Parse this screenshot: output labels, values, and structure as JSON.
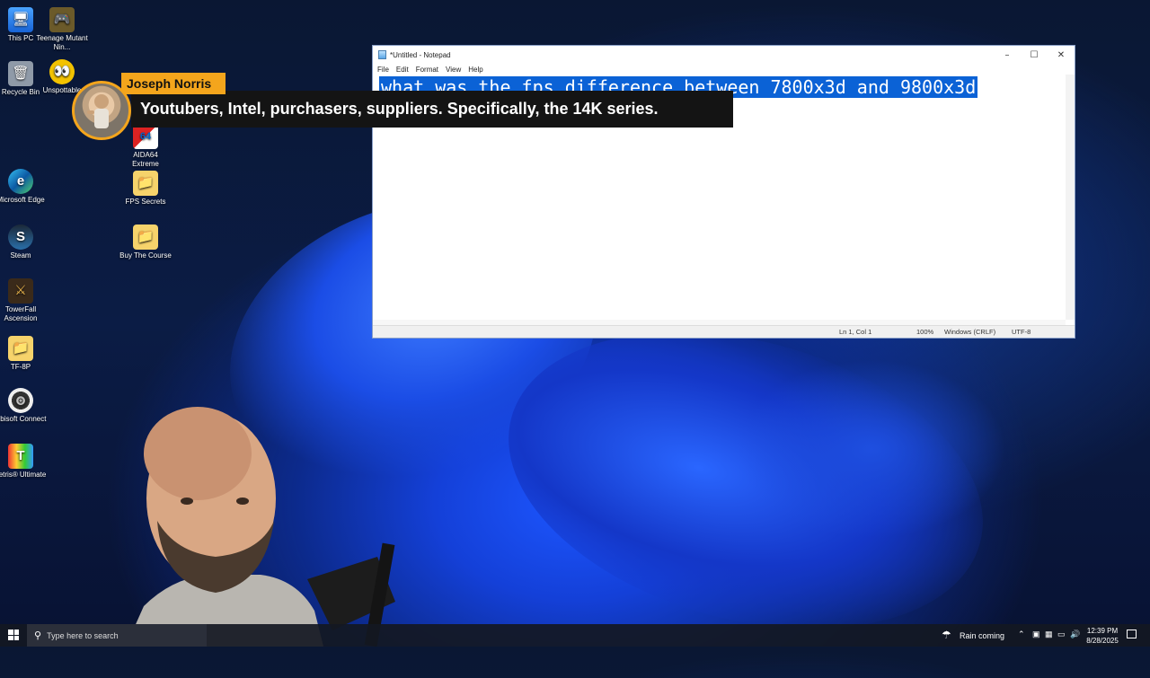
{
  "desktop_icons": [
    {
      "label": "This PC",
      "glyph": "🖥"
    },
    {
      "label": "Teenage Mutant Nin...",
      "glyph": "🎮"
    },
    {
      "label": "Recycle Bin",
      "glyph": "🗑"
    },
    {
      "label": "Unspottable",
      "glyph": "👀"
    },
    {
      "label": "AIDA64 Extreme",
      "glyph": "64"
    },
    {
      "label": "Microsoft Edge",
      "glyph": "e"
    },
    {
      "label": "FPS Secrets",
      "glyph": "📁"
    },
    {
      "label": "Steam",
      "glyph": "S"
    },
    {
      "label": "Buy The Course",
      "glyph": "📁"
    },
    {
      "label": "TowerFall Ascension",
      "glyph": "⚔"
    },
    {
      "label": "TF-8P",
      "glyph": "📁"
    },
    {
      "label": "Ubisoft Connect",
      "glyph": "◎"
    },
    {
      "label": "Tetris® Ultimate",
      "glyph": "T"
    }
  ],
  "notepad": {
    "title": "*Untitled - Notepad",
    "menu": [
      "File",
      "Edit",
      "Format",
      "View",
      "Help"
    ],
    "content": "what was the fps difference between 7800x3d and 9800x3d",
    "status": {
      "position": "Ln 1, Col 1",
      "zoom": "100%",
      "line_ending": "Windows (CRLF)",
      "encoding": "UTF-8"
    },
    "selection_color": "#0b62d6"
  },
  "overlay": {
    "speaker_name": "Joseph Norris",
    "caption": "Youtubers, Intel, purchasers, suppliers. Specifically, the 14K series.",
    "accent_color": "#f4a51c"
  },
  "taskbar": {
    "search_placeholder": "Type here to search",
    "weather": "Rain coming",
    "time": "12:39 PM",
    "date": "8/28/2025"
  }
}
